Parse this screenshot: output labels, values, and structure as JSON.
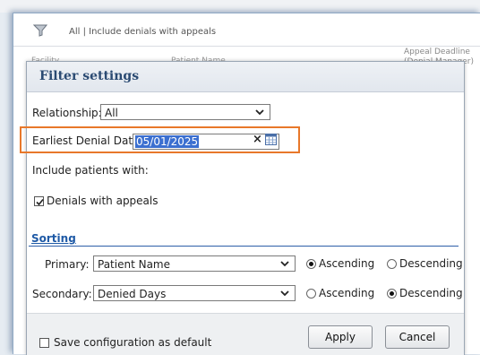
{
  "background": {
    "filter_summary": "All | Include denials with appeals",
    "col_left": "Facility",
    "col_mid": "Patient Name",
    "col_right_line1": "Appeal Deadline",
    "col_right_line2": "(Denial Manager)"
  },
  "dialog": {
    "title": "Filter settings",
    "relationship": {
      "label": "Relationship:",
      "value": "All"
    },
    "denial_date": {
      "label": "Earliest Denial Date:",
      "value": "05/01/2025"
    },
    "include_label": "Include patients with:",
    "denials_with_appeals": {
      "label": "Denials with appeals",
      "checked": true
    },
    "sorting": {
      "title": "Sorting",
      "primary": {
        "label": "Primary:",
        "value": "Patient Name",
        "ascending_label": "Ascending",
        "descending_label": "Descending",
        "order": "ascending"
      },
      "secondary": {
        "label": "Secondary:",
        "value": "Denied Days",
        "ascending_label": "Ascending",
        "descending_label": "Descending",
        "order": "descending"
      }
    },
    "save_default": {
      "label": "Save configuration as default",
      "checked": false
    },
    "apply_label": "Apply",
    "cancel_label": "Cancel"
  },
  "colors": {
    "highlight": "#e8782a",
    "title_text": "#2a4a72",
    "section_link": "#1f5aa6",
    "selection": "#3b6fd0"
  },
  "icons": [
    "filter-icon",
    "chevron-down-icon",
    "clear-icon",
    "calendar-icon",
    "checkbox-icon",
    "radio-icon"
  ]
}
